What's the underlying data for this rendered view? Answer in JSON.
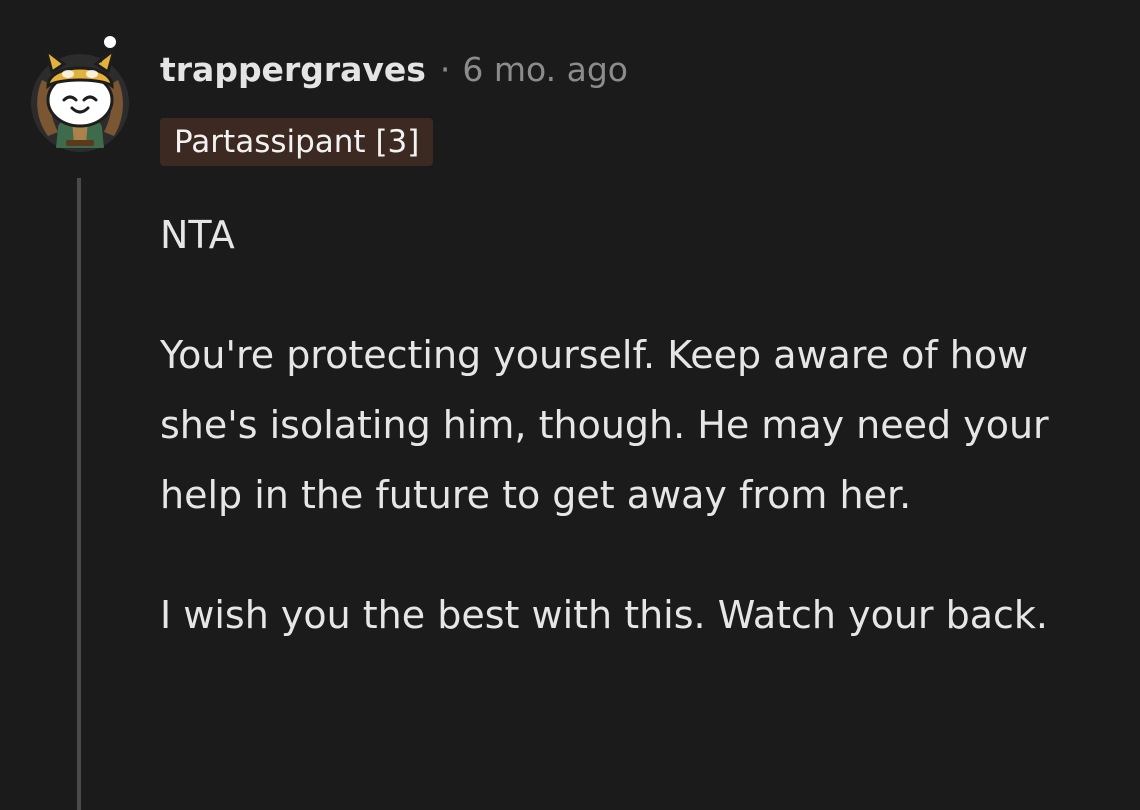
{
  "comment": {
    "username": "trappergraves",
    "separator": "·",
    "timestamp": "6 mo. ago",
    "flair": "Partassipant [3]",
    "paragraphs": [
      "NTA",
      "You're protecting yourself. Keep aware of how she's isolating him, though. He may need your help in the future to get away from her.",
      "I wish you the best with this. Watch your back."
    ]
  },
  "colors": {
    "background": "#1b1b1b",
    "text": "#e6e6e6",
    "muted": "#8c8c8c",
    "flair_background": "#3c2a22",
    "thread_line": "#4a4a4a"
  },
  "icons": {
    "avatar": "shiba-snoo-avatar-icon"
  }
}
